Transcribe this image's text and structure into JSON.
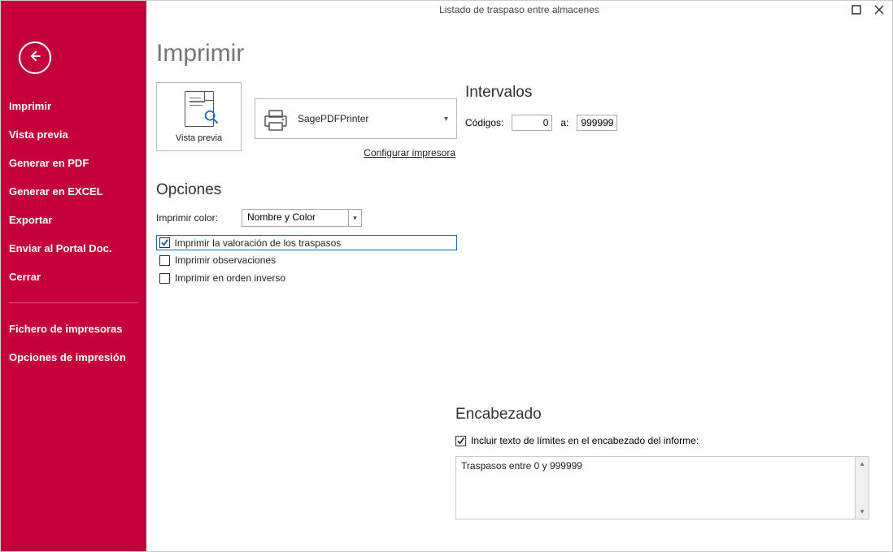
{
  "window": {
    "title": "Listado de traspaso entre almacenes"
  },
  "sidebar": {
    "items": [
      {
        "label": "Imprimir"
      },
      {
        "label": "Vista previa"
      },
      {
        "label": "Generar en PDF"
      },
      {
        "label": "Generar en EXCEL"
      },
      {
        "label": "Exportar"
      },
      {
        "label": "Enviar al Portal Doc."
      },
      {
        "label": "Cerrar"
      }
    ],
    "secondary": [
      {
        "label": "Fichero de impresoras"
      },
      {
        "label": "Opciones de impresión"
      }
    ]
  },
  "page": {
    "title": "Imprimir",
    "preview_label": "Vista previa",
    "printer_name": "SagePDFPrinter",
    "configure_link": "Configurar impresora"
  },
  "opciones": {
    "heading": "Opciones",
    "color_label": "Imprimir color:",
    "color_value": "Nombre y Color",
    "chk_valoracion": {
      "label": "Imprimir la valoración de los traspasos",
      "checked": true
    },
    "chk_obs": {
      "label": "Imprimir observaciones",
      "checked": false
    },
    "chk_inverso": {
      "label": "Imprimir en orden inverso",
      "checked": false
    }
  },
  "intervalos": {
    "heading": "Intervalos",
    "codigos_label": "Códigos:",
    "from": "0",
    "sep": "a:",
    "to": "999999"
  },
  "encabezado": {
    "heading": "Encabezado",
    "chk_limits": {
      "label": "Incluir texto de límites en el encabezado del informe:",
      "checked": true
    },
    "text": "Traspasos entre 0 y 999999"
  }
}
